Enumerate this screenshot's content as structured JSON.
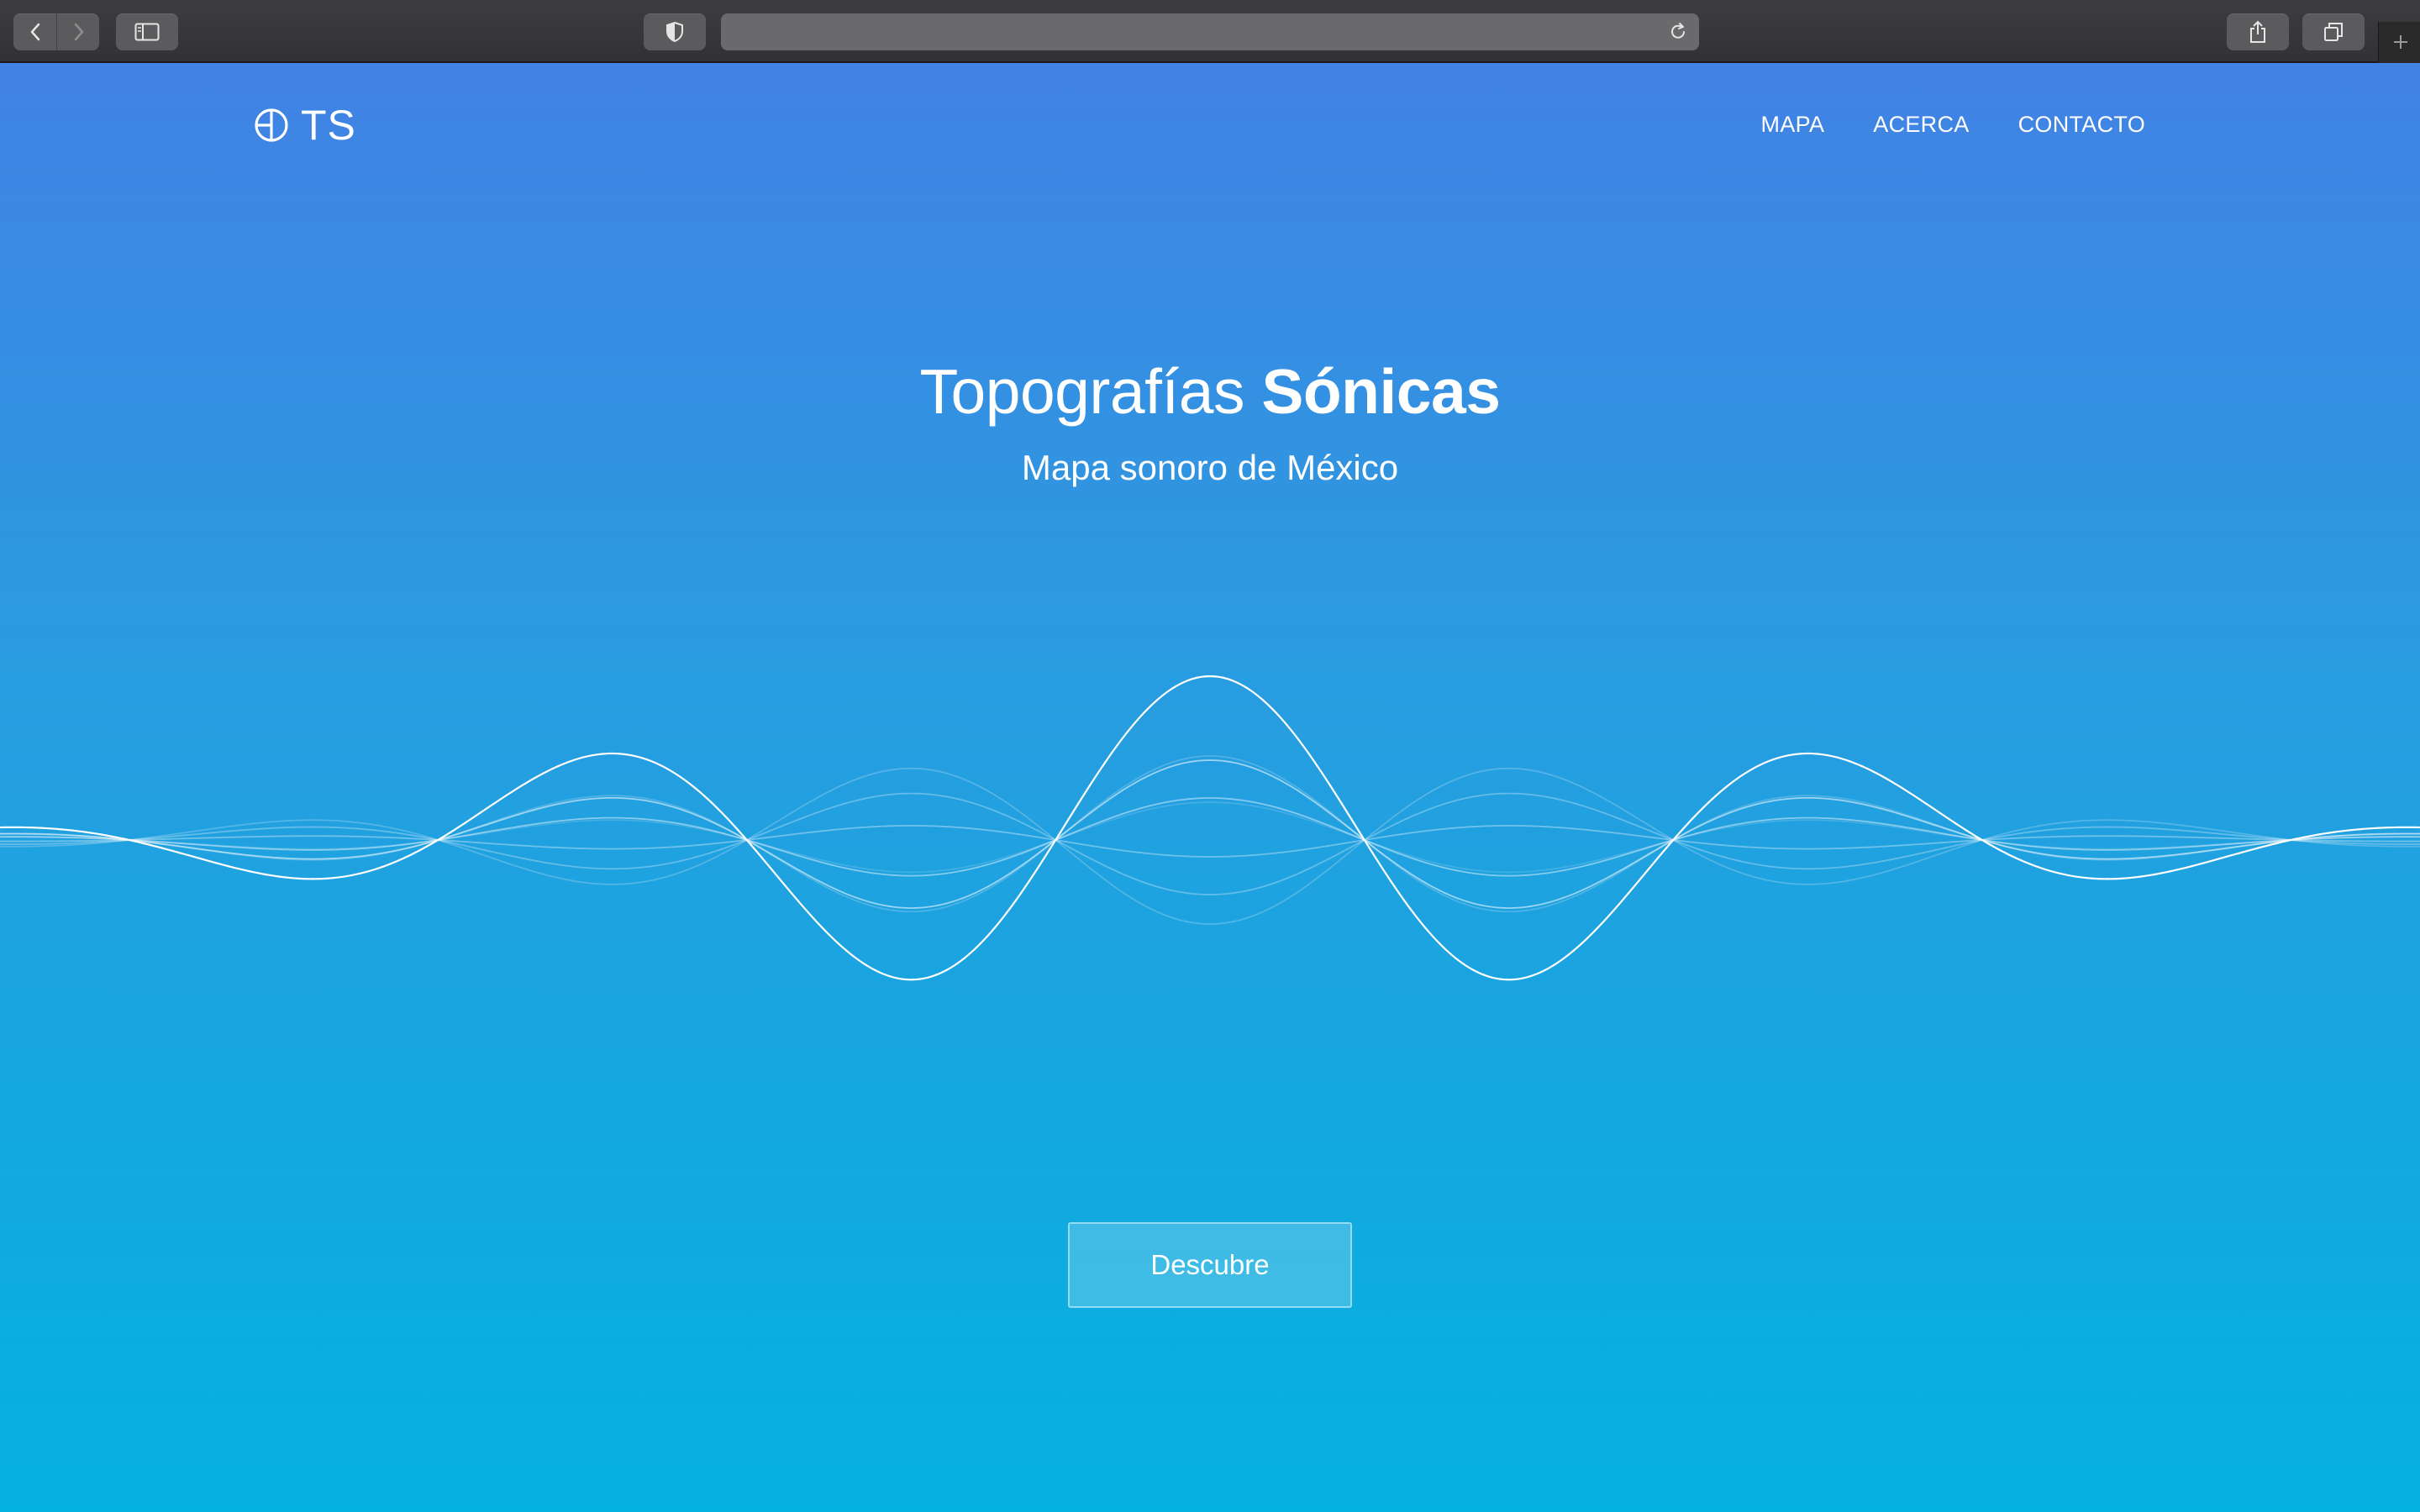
{
  "browser": {
    "url_text": "",
    "icons": {
      "back": "chevron-left-icon",
      "forward": "chevron-right-icon",
      "sidebar": "sidebar-icon",
      "privacy": "shield-icon",
      "reload": "reload-icon",
      "share": "share-icon",
      "tabs": "tabs-icon",
      "new_tab": "plus-icon"
    }
  },
  "site": {
    "logo_text": "TS",
    "logo_icon": "circle-grid-icon",
    "nav": [
      {
        "label": "MAPA"
      },
      {
        "label": "ACERCA"
      },
      {
        "label": "CONTACTO"
      }
    ]
  },
  "hero": {
    "title_light": "Topografías",
    "title_bold": "Sónicas",
    "subtitle": "Mapa sonoro de México",
    "cta_label": "Descubre"
  },
  "colors": {
    "gradient_top": "#4182e4",
    "gradient_bottom": "#05b1e0",
    "text": "#ffffff"
  }
}
